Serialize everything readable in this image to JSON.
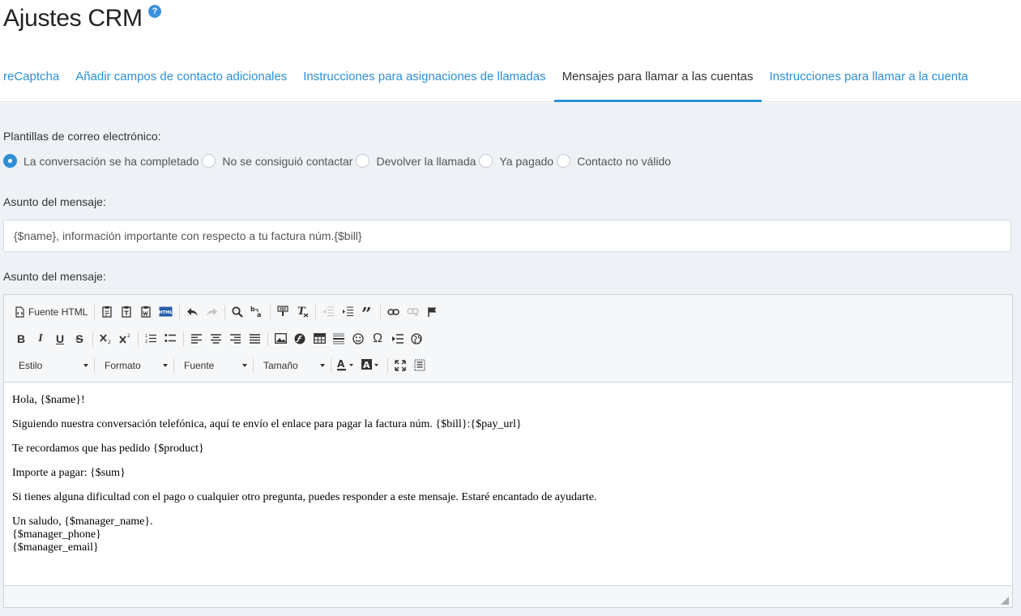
{
  "page": {
    "title": "Ajustes CRM",
    "help_icon": "?"
  },
  "tabs": [
    {
      "label": "reCaptcha",
      "active": false
    },
    {
      "label": "Añadir campos de contacto adicionales",
      "active": false
    },
    {
      "label": "Instrucciones para asignaciones de llamadas",
      "active": false
    },
    {
      "label": "Mensajes para llamar a las cuentas",
      "active": true
    },
    {
      "label": "Instrucciones para llamar a la cuenta",
      "active": false
    }
  ],
  "templates": {
    "label": "Plantillas de correo electrónico:",
    "options": [
      {
        "label": "La conversación se ha completado",
        "checked": true
      },
      {
        "label": "No se consiguió contactar",
        "checked": false
      },
      {
        "label": "Devolver la llamada",
        "checked": false
      },
      {
        "label": "Ya pagado",
        "checked": false
      },
      {
        "label": "Contacto no válido",
        "checked": false
      }
    ]
  },
  "subject": {
    "label": "Asunto del mensaje:",
    "value": "{$name}, información importante con respecto a tu factura núm.{$bill}"
  },
  "body": {
    "label": "Asunto del mensaje:"
  },
  "toolbar": {
    "source_label": "Fuente HTML",
    "combo_style": "Estilo",
    "combo_format": "Formato",
    "combo_font": "Fuente",
    "combo_size": "Tamaño"
  },
  "editor_content": {
    "line1": "Hola, {$name}!",
    "line2": "Siguiendo nuestra conversación telefónica, aquí te envío el enlace para pagar la factura núm. {$bill}:{$pay_url}",
    "line3": "Te recordamos que has pedido {$product}",
    "line4": "Importe a pagar: {$sum}",
    "line5": "Si tienes alguna dificultad con el pago o cualquier otro pregunta, puedes responder a este mensaje. Estaré encantado de ayudarte.",
    "line6a": "Un saludo, {$manager_name}.",
    "line6b": "{$manager_phone}",
    "line6c": "{$manager_email}"
  },
  "colors": {
    "accent": "#2d8fd6",
    "background": "#eef1f5"
  }
}
